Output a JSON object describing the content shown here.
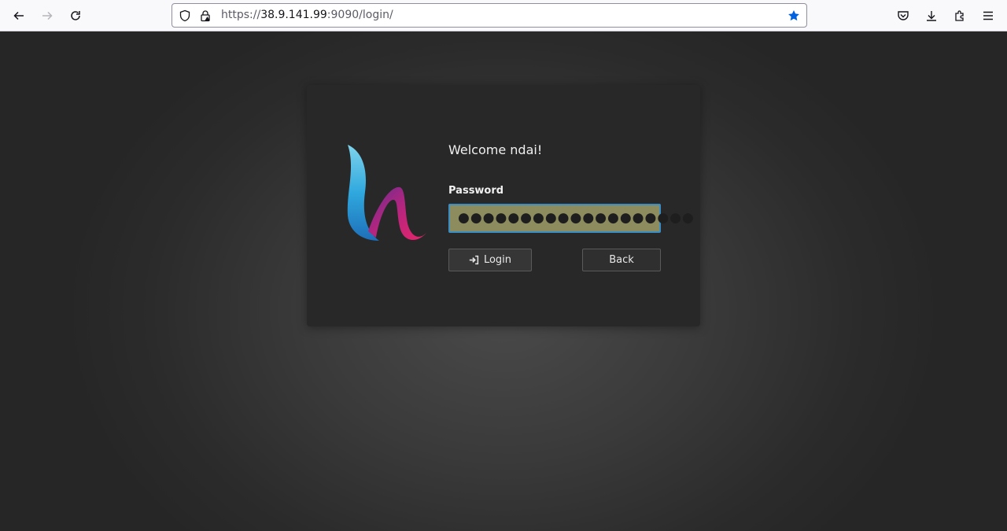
{
  "browser": {
    "url_scheme": "https://",
    "url_host": "38.9.141.99",
    "url_rest": ":9090/login/",
    "icons": [
      "back-icon",
      "forward-icon",
      "reload-icon",
      "shield-icon",
      "lock-icon",
      "bookmark-star-icon",
      "pocket-icon",
      "download-icon",
      "extensions-icon",
      "menu-icon"
    ]
  },
  "login": {
    "welcome": "Welcome ndai!",
    "password_label": "Password",
    "password_value": "●●●●●●●●●●●●●●●●●●●",
    "login_button": "Login",
    "back_button": "Back"
  },
  "colors": {
    "accent": "#3b8ec4",
    "input_fill": "#8c8c5e",
    "card": "#282828"
  }
}
